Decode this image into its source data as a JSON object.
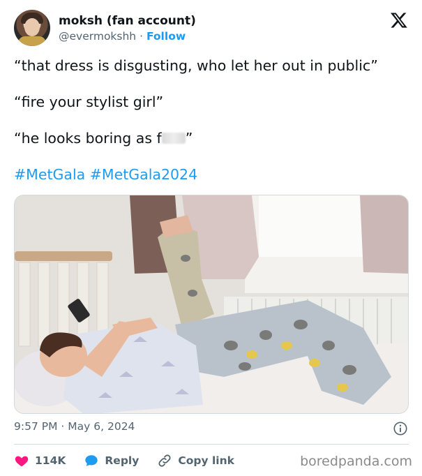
{
  "author": {
    "name": "moksh (fan account)",
    "handle": "@evermokshh",
    "separator": "·",
    "follow_label": "Follow"
  },
  "tweet": {
    "line1": "“that dress is disgusting, who let her out in public”",
    "line2": "“fire your stylist girl”",
    "line3_prefix": "“he looks boring as f",
    "line3_suffix": "”",
    "hashtags": "#MetGala #MetGala2024"
  },
  "meta": {
    "time": "9:57 PM",
    "separator": "·",
    "date": "May 6, 2024"
  },
  "actions": {
    "likes": "114K",
    "reply_label": "Reply",
    "copy_link_label": "Copy link"
  },
  "watermark": "boredpanda.com",
  "icons": [
    "x-logo-icon",
    "info-icon",
    "heart-icon",
    "reply-bubble-icon",
    "link-icon"
  ],
  "colors": {
    "link_blue": "#1d9bf0",
    "heart_red": "#f91880",
    "secondary_text": "#536471"
  }
}
